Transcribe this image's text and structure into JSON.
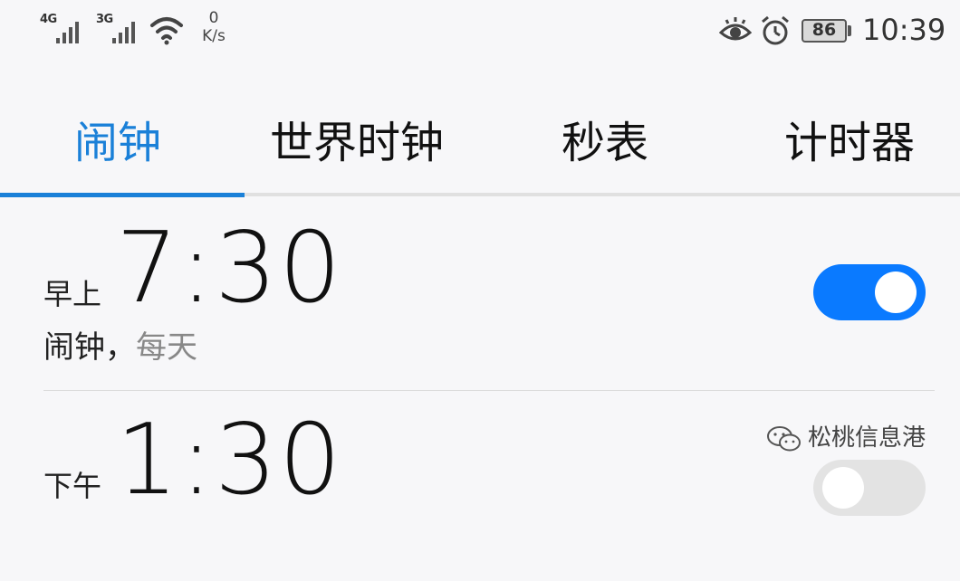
{
  "status_bar": {
    "sim1_net": "4G",
    "sim2_net": "3G",
    "net_speed_value": "0",
    "net_speed_unit": "K/s",
    "icons": [
      "signal-icon",
      "wifi-icon",
      "eye-comfort-icon",
      "alarm-clock-icon",
      "battery-icon"
    ],
    "battery_level": "86",
    "time": "10:39"
  },
  "tabs": [
    {
      "label": "闹钟",
      "active": true
    },
    {
      "label": "世界时钟",
      "active": false
    },
    {
      "label": "秒表",
      "active": false
    },
    {
      "label": "计时器",
      "active": false
    }
  ],
  "alarms": [
    {
      "period": "早上",
      "time": "7:30",
      "label": "闹钟",
      "separator": "，",
      "repeat": "每天",
      "enabled": true
    },
    {
      "period": "下午",
      "time": "1:30",
      "enabled": false
    }
  ],
  "watermark": {
    "text": "松桃信息港"
  },
  "colors": {
    "accent": "#1a80d8",
    "toggle_on": "#0a7aff",
    "background": "#f7f7f9"
  }
}
